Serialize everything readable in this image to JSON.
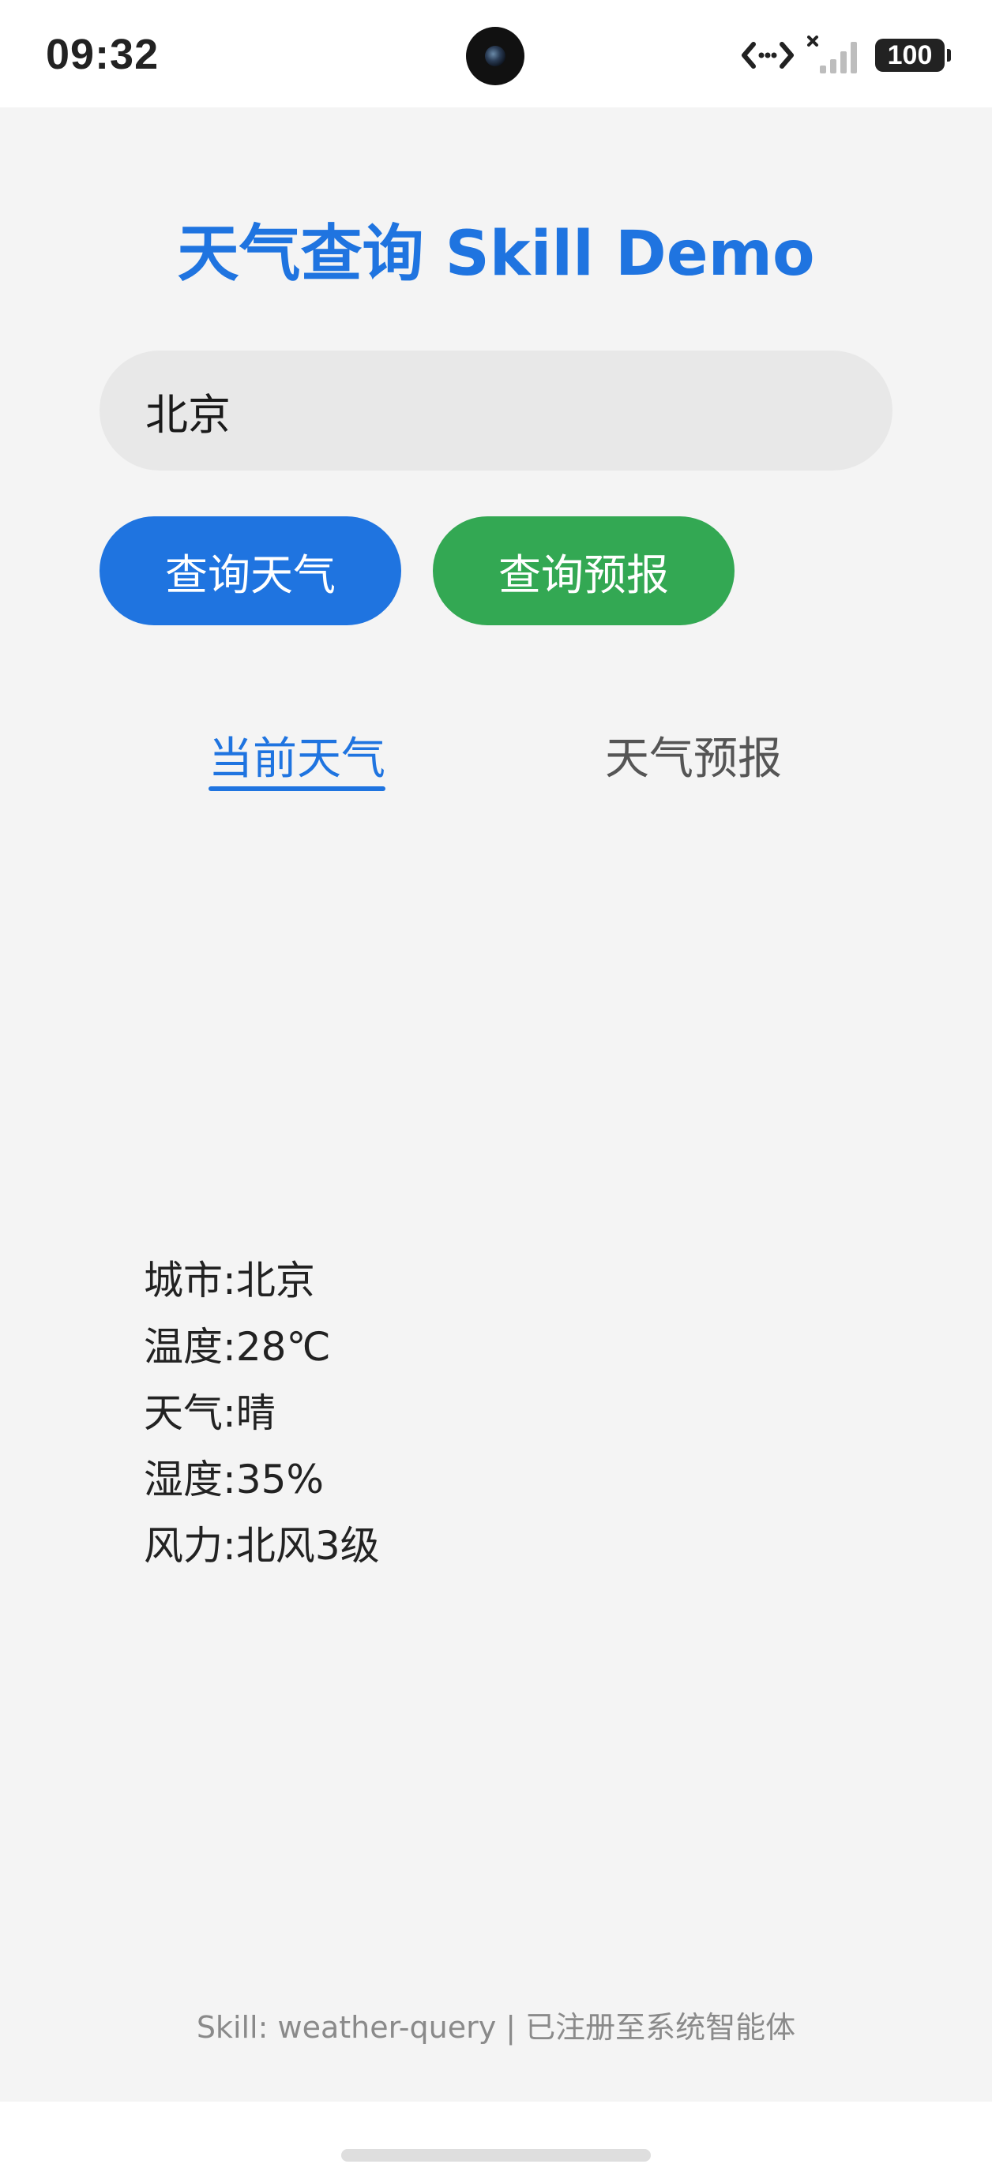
{
  "status_bar": {
    "time": "09:32",
    "battery": "100"
  },
  "app": {
    "title": "天气查询 Skill Demo"
  },
  "search": {
    "value": "北京",
    "placeholder": ""
  },
  "buttons": {
    "current_label": "查询天气",
    "forecast_label": "查询预报"
  },
  "tabs": [
    {
      "label": "当前天气",
      "active": true
    },
    {
      "label": "天气预报",
      "active": false
    }
  ],
  "weather": {
    "rows": [
      {
        "label": "城市:",
        "value": "北京"
      },
      {
        "label": "温度:",
        "value": "28℃"
      },
      {
        "label": "天气:",
        "value": "晴"
      },
      {
        "label": "湿度:",
        "value": "35%"
      },
      {
        "label": "风力:",
        "value": "北风3级"
      }
    ]
  },
  "footer": {
    "text": "Skill: weather-query | 已注册至系统智能体"
  },
  "icons": {
    "camera": "front-camera-icon",
    "data": "data-transfer-icon",
    "signal": "signal-strength-icon",
    "battery": "battery-icon"
  },
  "colors": {
    "primary": "#1f74e0",
    "success": "#33a853",
    "background": "#f4f4f4",
    "input_bg": "#e8e8e8",
    "muted_text": "#8a8a8a"
  }
}
